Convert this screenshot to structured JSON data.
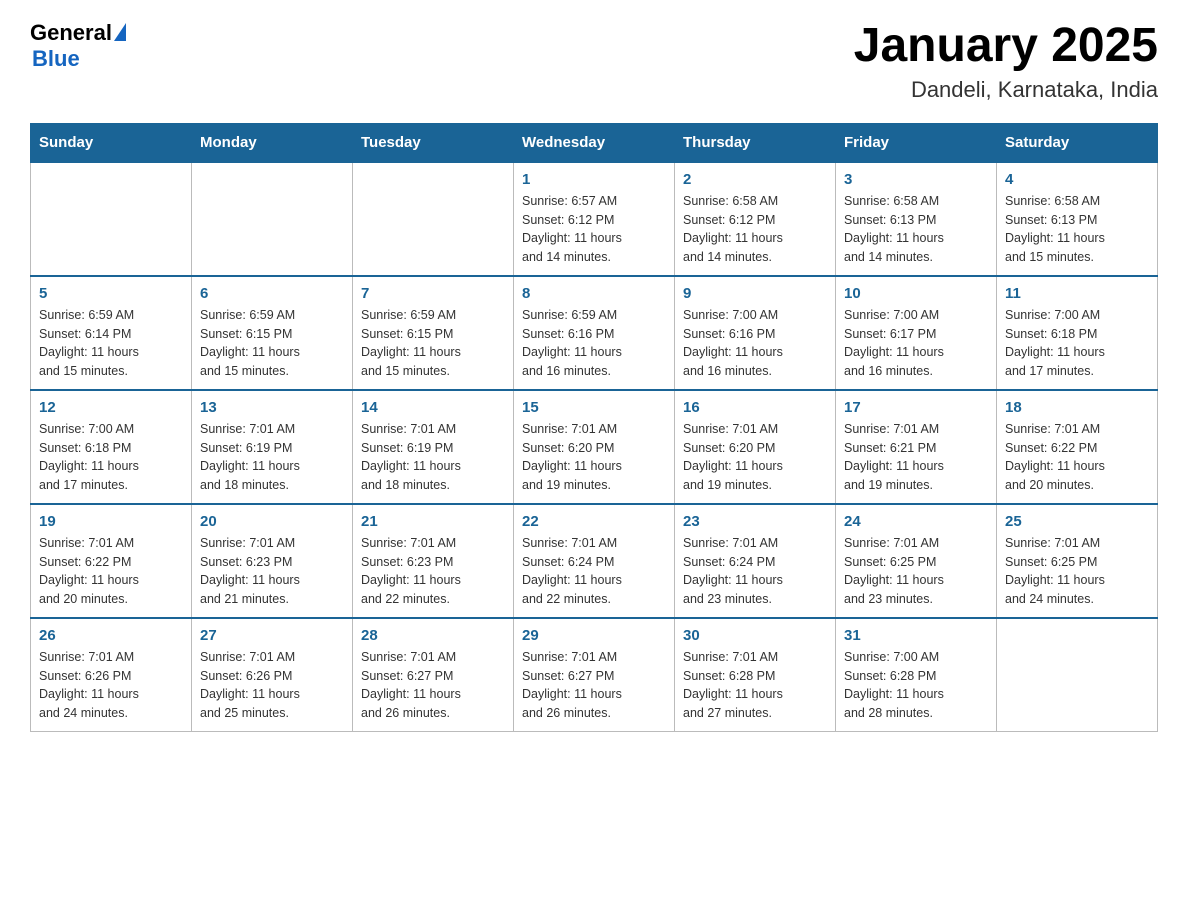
{
  "header": {
    "logo_general": "General",
    "logo_blue": "Blue",
    "title": "January 2025",
    "subtitle": "Dandeli, Karnataka, India"
  },
  "days_of_week": [
    "Sunday",
    "Monday",
    "Tuesday",
    "Wednesday",
    "Thursday",
    "Friday",
    "Saturday"
  ],
  "weeks": [
    [
      {
        "day": "",
        "info": ""
      },
      {
        "day": "",
        "info": ""
      },
      {
        "day": "",
        "info": ""
      },
      {
        "day": "1",
        "info": "Sunrise: 6:57 AM\nSunset: 6:12 PM\nDaylight: 11 hours\nand 14 minutes."
      },
      {
        "day": "2",
        "info": "Sunrise: 6:58 AM\nSunset: 6:12 PM\nDaylight: 11 hours\nand 14 minutes."
      },
      {
        "day": "3",
        "info": "Sunrise: 6:58 AM\nSunset: 6:13 PM\nDaylight: 11 hours\nand 14 minutes."
      },
      {
        "day": "4",
        "info": "Sunrise: 6:58 AM\nSunset: 6:13 PM\nDaylight: 11 hours\nand 15 minutes."
      }
    ],
    [
      {
        "day": "5",
        "info": "Sunrise: 6:59 AM\nSunset: 6:14 PM\nDaylight: 11 hours\nand 15 minutes."
      },
      {
        "day": "6",
        "info": "Sunrise: 6:59 AM\nSunset: 6:15 PM\nDaylight: 11 hours\nand 15 minutes."
      },
      {
        "day": "7",
        "info": "Sunrise: 6:59 AM\nSunset: 6:15 PM\nDaylight: 11 hours\nand 15 minutes."
      },
      {
        "day": "8",
        "info": "Sunrise: 6:59 AM\nSunset: 6:16 PM\nDaylight: 11 hours\nand 16 minutes."
      },
      {
        "day": "9",
        "info": "Sunrise: 7:00 AM\nSunset: 6:16 PM\nDaylight: 11 hours\nand 16 minutes."
      },
      {
        "day": "10",
        "info": "Sunrise: 7:00 AM\nSunset: 6:17 PM\nDaylight: 11 hours\nand 16 minutes."
      },
      {
        "day": "11",
        "info": "Sunrise: 7:00 AM\nSunset: 6:18 PM\nDaylight: 11 hours\nand 17 minutes."
      }
    ],
    [
      {
        "day": "12",
        "info": "Sunrise: 7:00 AM\nSunset: 6:18 PM\nDaylight: 11 hours\nand 17 minutes."
      },
      {
        "day": "13",
        "info": "Sunrise: 7:01 AM\nSunset: 6:19 PM\nDaylight: 11 hours\nand 18 minutes."
      },
      {
        "day": "14",
        "info": "Sunrise: 7:01 AM\nSunset: 6:19 PM\nDaylight: 11 hours\nand 18 minutes."
      },
      {
        "day": "15",
        "info": "Sunrise: 7:01 AM\nSunset: 6:20 PM\nDaylight: 11 hours\nand 19 minutes."
      },
      {
        "day": "16",
        "info": "Sunrise: 7:01 AM\nSunset: 6:20 PM\nDaylight: 11 hours\nand 19 minutes."
      },
      {
        "day": "17",
        "info": "Sunrise: 7:01 AM\nSunset: 6:21 PM\nDaylight: 11 hours\nand 19 minutes."
      },
      {
        "day": "18",
        "info": "Sunrise: 7:01 AM\nSunset: 6:22 PM\nDaylight: 11 hours\nand 20 minutes."
      }
    ],
    [
      {
        "day": "19",
        "info": "Sunrise: 7:01 AM\nSunset: 6:22 PM\nDaylight: 11 hours\nand 20 minutes."
      },
      {
        "day": "20",
        "info": "Sunrise: 7:01 AM\nSunset: 6:23 PM\nDaylight: 11 hours\nand 21 minutes."
      },
      {
        "day": "21",
        "info": "Sunrise: 7:01 AM\nSunset: 6:23 PM\nDaylight: 11 hours\nand 22 minutes."
      },
      {
        "day": "22",
        "info": "Sunrise: 7:01 AM\nSunset: 6:24 PM\nDaylight: 11 hours\nand 22 minutes."
      },
      {
        "day": "23",
        "info": "Sunrise: 7:01 AM\nSunset: 6:24 PM\nDaylight: 11 hours\nand 23 minutes."
      },
      {
        "day": "24",
        "info": "Sunrise: 7:01 AM\nSunset: 6:25 PM\nDaylight: 11 hours\nand 23 minutes."
      },
      {
        "day": "25",
        "info": "Sunrise: 7:01 AM\nSunset: 6:25 PM\nDaylight: 11 hours\nand 24 minutes."
      }
    ],
    [
      {
        "day": "26",
        "info": "Sunrise: 7:01 AM\nSunset: 6:26 PM\nDaylight: 11 hours\nand 24 minutes."
      },
      {
        "day": "27",
        "info": "Sunrise: 7:01 AM\nSunset: 6:26 PM\nDaylight: 11 hours\nand 25 minutes."
      },
      {
        "day": "28",
        "info": "Sunrise: 7:01 AM\nSunset: 6:27 PM\nDaylight: 11 hours\nand 26 minutes."
      },
      {
        "day": "29",
        "info": "Sunrise: 7:01 AM\nSunset: 6:27 PM\nDaylight: 11 hours\nand 26 minutes."
      },
      {
        "day": "30",
        "info": "Sunrise: 7:01 AM\nSunset: 6:28 PM\nDaylight: 11 hours\nand 27 minutes."
      },
      {
        "day": "31",
        "info": "Sunrise: 7:00 AM\nSunset: 6:28 PM\nDaylight: 11 hours\nand 28 minutes."
      },
      {
        "day": "",
        "info": ""
      }
    ]
  ]
}
